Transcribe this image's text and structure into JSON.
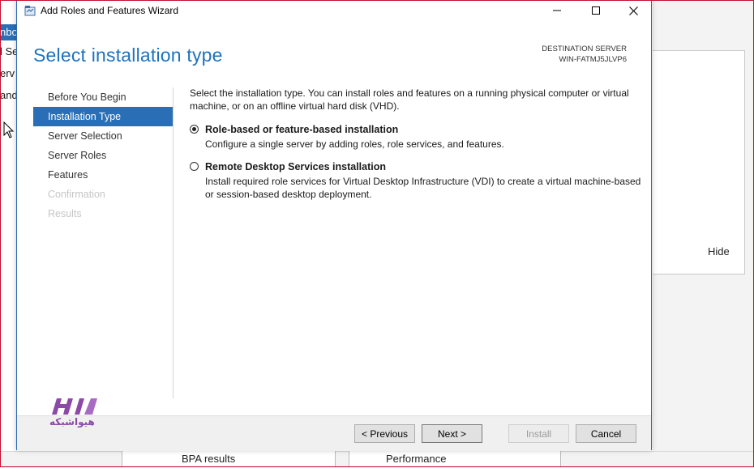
{
  "background": {
    "left_fragments": [
      "nbo",
      "l Se",
      "erv",
      "and"
    ],
    "hide_label": "Hide",
    "bottom_tiles": [
      "BPA results",
      "Performance"
    ]
  },
  "dialog": {
    "window_title": "Add Roles and Features Wizard",
    "page_title": "Select installation type",
    "destination": {
      "label": "DESTINATION SERVER",
      "server": "WIN-FATMJ5JLVP6"
    },
    "nav": [
      {
        "label": "Before You Begin",
        "state": "normal"
      },
      {
        "label": "Installation Type",
        "state": "active"
      },
      {
        "label": "Server Selection",
        "state": "normal"
      },
      {
        "label": "Server Roles",
        "state": "normal"
      },
      {
        "label": "Features",
        "state": "normal"
      },
      {
        "label": "Confirmation",
        "state": "disabled"
      },
      {
        "label": "Results",
        "state": "disabled"
      }
    ],
    "intro": "Select the installation type. You can install roles and features on a running physical computer or virtual machine, or on an offline virtual hard disk (VHD).",
    "options": [
      {
        "title": "Role-based or feature-based installation",
        "description": "Configure a single server by adding roles, role services, and features.",
        "selected": true
      },
      {
        "title": "Remote Desktop Services installation",
        "description": "Install required role services for Virtual Desktop Infrastructure (VDI) to create a virtual machine-based or session-based desktop deployment.",
        "selected": false
      }
    ],
    "buttons": {
      "previous": "< Previous",
      "next": "Next >",
      "install": "Install",
      "cancel": "Cancel"
    }
  },
  "watermark": {
    "text": "هیواشبکه"
  },
  "colors": {
    "accent": "#2a6fb5",
    "title_blue": "#1e73be",
    "frame_red": "#c8102e",
    "logo_purple": "#8a4aa6"
  },
  "icons": {
    "window_icon": "wizard-icon",
    "minimize": "minimize-icon",
    "maximize": "maximize-icon",
    "close": "close-icon"
  }
}
